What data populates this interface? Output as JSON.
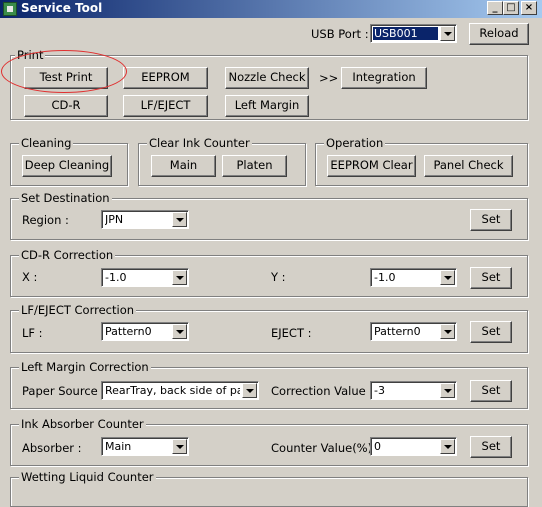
{
  "window": {
    "title": "Service Tool",
    "minimize": "_",
    "maximize": "□",
    "close": "×"
  },
  "usb": {
    "label": "USB Port :",
    "value": "USB001",
    "reload": "Reload"
  },
  "print": {
    "title": "Print",
    "test_print": "Test Print",
    "eeprom": "EEPROM",
    "nozzle_check": "Nozzle Check",
    "arrows": ">>",
    "integration": "Integration",
    "cdr": "CD-R",
    "lf_eject": "LF/EJECT",
    "left_margin": "Left Margin"
  },
  "cleaning": {
    "title": "Cleaning",
    "deep_cleaning": "Deep Cleaning"
  },
  "clear_ink": {
    "title": "Clear Ink Counter",
    "main": "Main",
    "platen": "Platen"
  },
  "operation": {
    "title": "Operation",
    "eeprom_clear": "EEPROM Clear",
    "panel_check": "Panel Check"
  },
  "destination": {
    "title": "Set Destination",
    "region_label": "Region :",
    "region_value": "JPN",
    "set": "Set"
  },
  "cdr_correction": {
    "title": "CD-R Correction",
    "x_label": "X :",
    "x_value": "-1.0",
    "y_label": "Y :",
    "y_value": "-1.0",
    "set": "Set"
  },
  "lf_correction": {
    "title": "LF/EJECT Correction",
    "lf_label": "LF :",
    "lf_value": "Pattern0",
    "eject_label": "EJECT :",
    "eject_value": "Pattern0",
    "set": "Set"
  },
  "margin_correction": {
    "title": "Left Margin Correction",
    "source_label": "Paper Source :",
    "source_value": "RearTray, back side of paper",
    "corr_label": "Correction Value :",
    "corr_value": "-3",
    "set": "Set"
  },
  "absorber": {
    "title": "Ink Absorber Counter",
    "absorber_label": "Absorber :",
    "absorber_value": "Main",
    "counter_label": "Counter Value(%) :",
    "counter_value": "0",
    "set": "Set"
  },
  "wetting": {
    "title": "Wetting Liquid Counter"
  },
  "colors": {
    "title_bar": "#0a246a",
    "face": "#d4d0c8",
    "highlight_circle": "#e03030"
  }
}
